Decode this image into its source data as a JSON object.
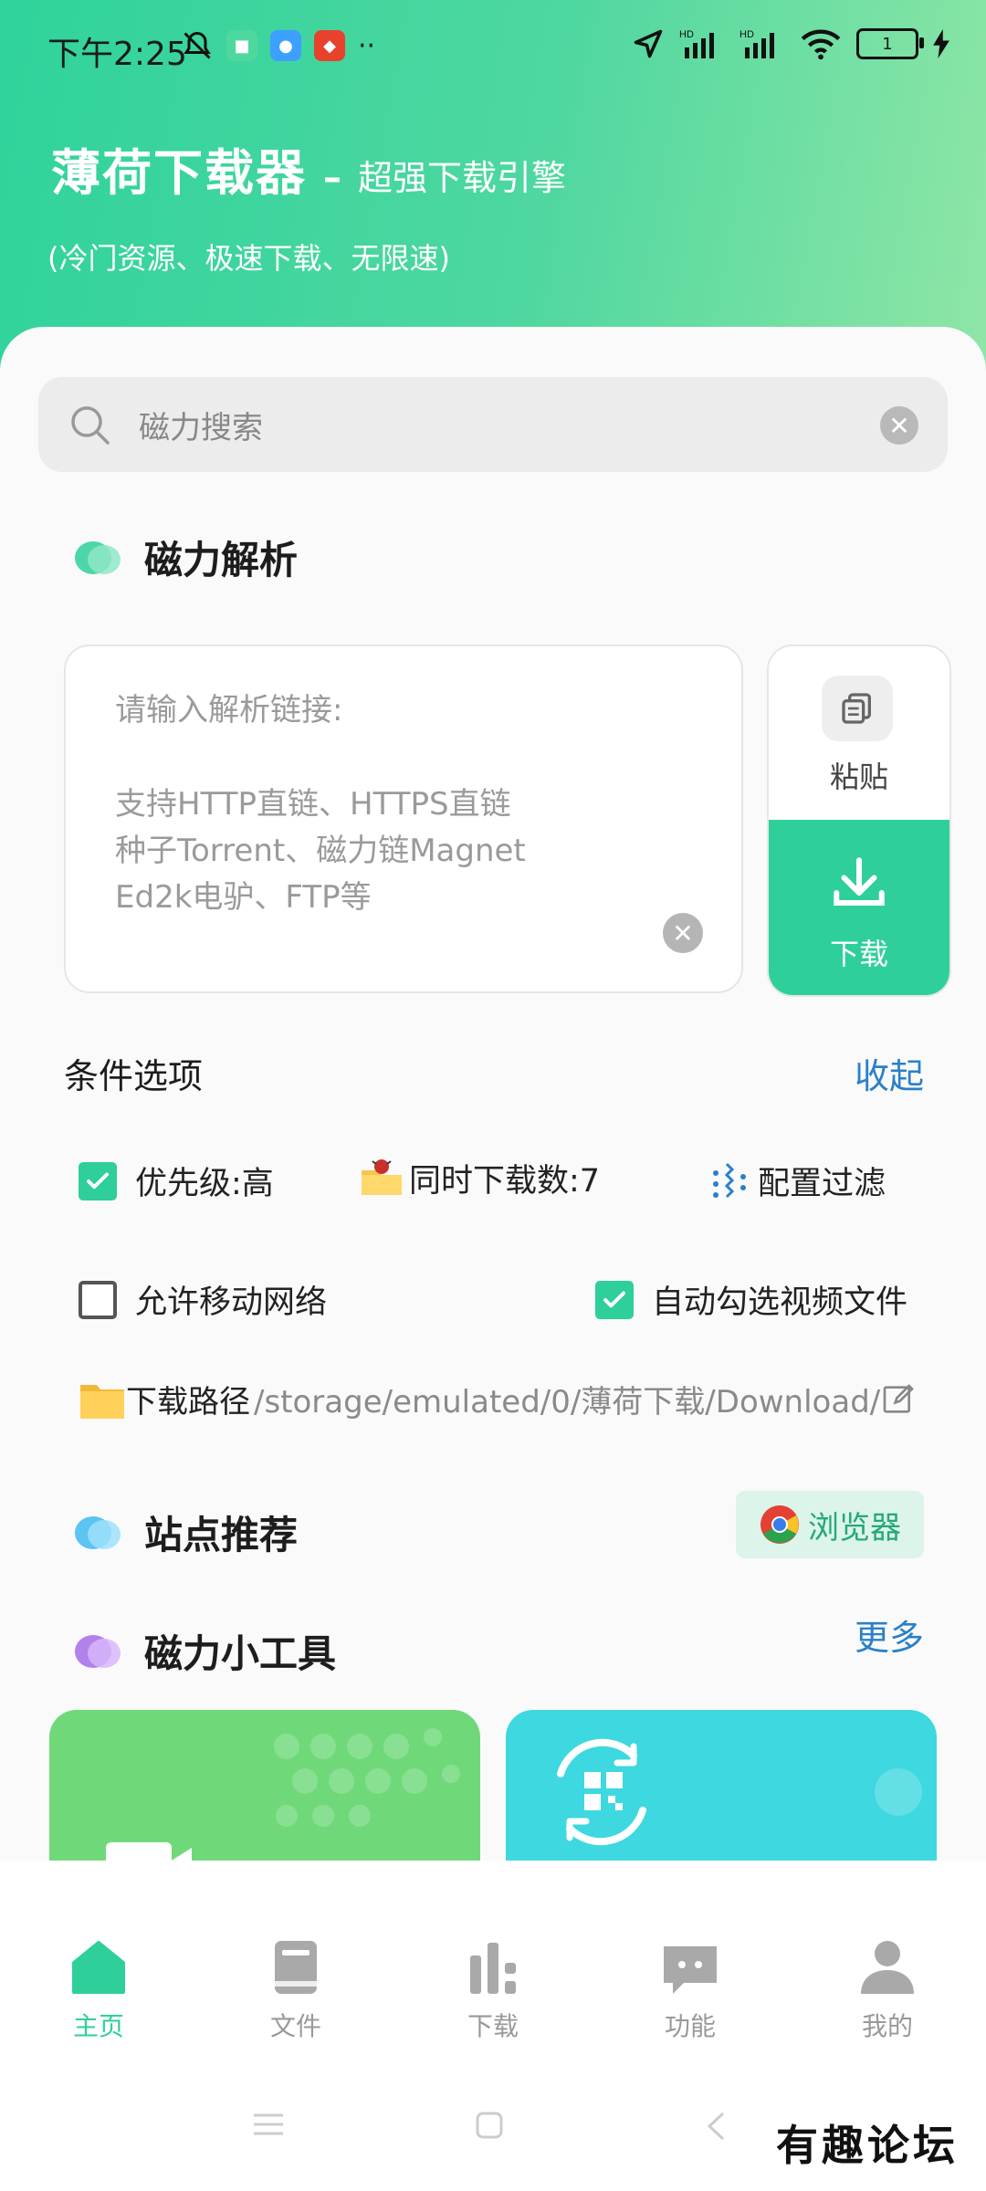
{
  "status_bar": {
    "time": "下午2:25",
    "more": "··",
    "battery": "1"
  },
  "header": {
    "app_name": "薄荷下载器",
    "dash": "–",
    "subtitle": "超强下载引擎",
    "description": "(冷门资源、极速下载、无限速)"
  },
  "search": {
    "placeholder": "磁力搜索"
  },
  "magnet_parse": {
    "title": "磁力解析",
    "input_prompt": "请输入解析链接:",
    "support_lines": [
      "支持HTTP直链、HTTPS直链",
      "种子Torrent、磁力链Magnet",
      "Ed2k电驴、FTP等"
    ],
    "paste_label": "粘贴",
    "download_label": "下载"
  },
  "options": {
    "title": "条件选项",
    "collapse_label": "收起",
    "priority_label": "优先级:高",
    "priority_checked": true,
    "concurrent_label": "同时下载数:7",
    "filter_label": "配置过滤",
    "mobile_network_label": "允许移动网络",
    "mobile_network_checked": false,
    "auto_select_label": "自动勾选视频文件",
    "auto_select_checked": true,
    "path_label": "下载路径",
    "path_value": "/storage/emulated/0/薄荷下载/Download/"
  },
  "sites": {
    "title": "站点推荐",
    "browser_label": "浏览器"
  },
  "tools": {
    "title": "磁力小工具",
    "more_label": "更多"
  },
  "bottom_nav": [
    {
      "label": "主页",
      "icon": "home-icon",
      "active": true
    },
    {
      "label": "文件",
      "icon": "book-icon",
      "active": false
    },
    {
      "label": "下载",
      "icon": "bars-icon",
      "active": false
    },
    {
      "label": "功能",
      "icon": "chat-icon",
      "active": false
    },
    {
      "label": "我的",
      "icon": "user-icon",
      "active": false
    }
  ],
  "watermark": "有趣论坛",
  "colors": {
    "accent": "#2ecf9b",
    "link": "#2a80c9"
  }
}
